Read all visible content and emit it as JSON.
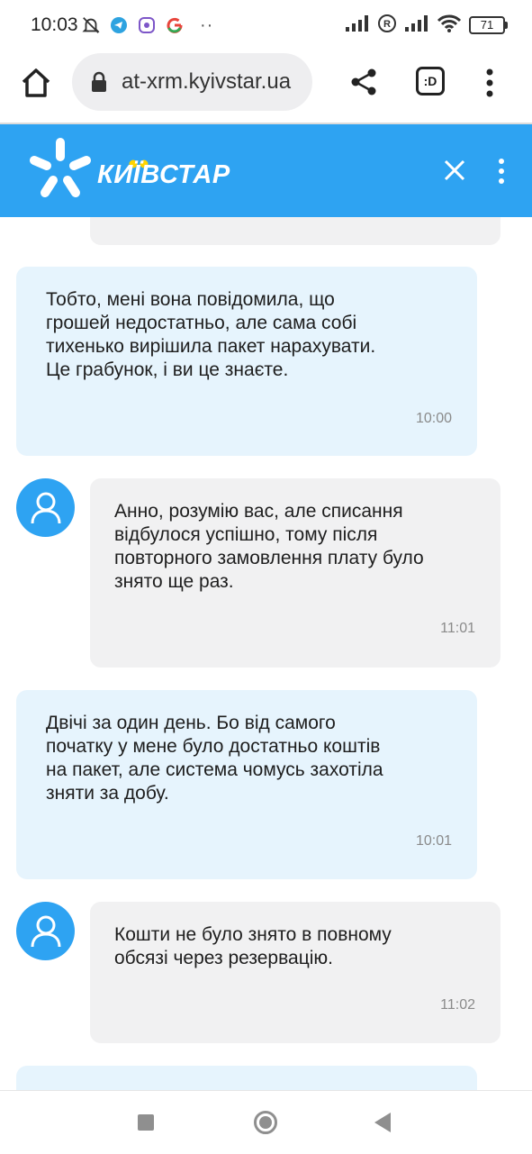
{
  "status_bar": {
    "time": "10:03",
    "battery": "71",
    "left_icons": [
      "mute-icon",
      "telegram-icon",
      "viber-icon",
      "google-icon"
    ],
    "overflow": "··"
  },
  "browser": {
    "url": "at-xrm.kyivstar.ua",
    "tabs_label": ":D"
  },
  "header": {
    "brand": "КИЇВСТАР",
    "accent_color": "#2ea3f2",
    "dots_color": "#ffd400"
  },
  "messages": [
    {
      "from": "user",
      "text": "Тобто, мені вона повідомила, що\nгрошей недостатньо, але сама собі\nтихенько вирішила пакет нарахувати.\nЦе грабунок, і ви це знаєте.",
      "time": "10:00"
    },
    {
      "from": "agent",
      "text": "Анно, розумію вас, але списання\nвідбулося успішно, тому після\nповторного замовлення плату було\nзнято ще раз.",
      "time": "11:01"
    },
    {
      "from": "user",
      "text": "Двічі за один день. Бо від самого\nпочатку у мене було достатньо коштів\nна пакет, але система чомусь захотіла\nзняти за добу.",
      "time": "10:01"
    },
    {
      "from": "agent",
      "text": "Кошти не було знято в повному\nобсязі через резервацію.",
      "time": "11:02"
    }
  ]
}
